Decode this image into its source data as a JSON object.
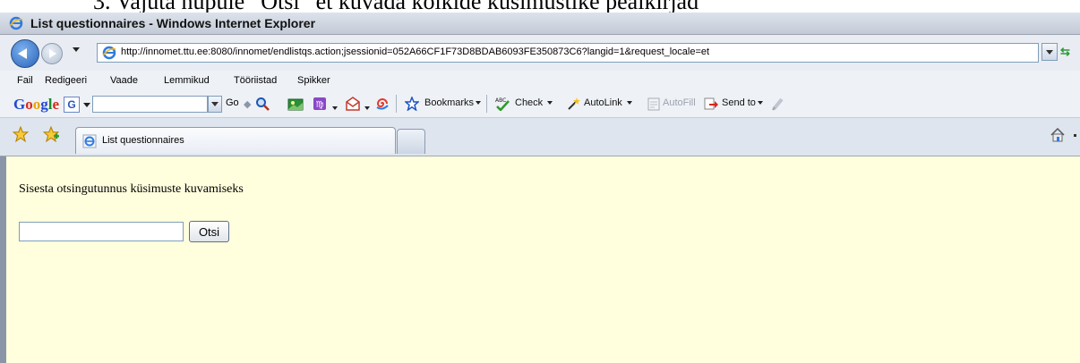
{
  "document": {
    "caption_text": "3.   Vajuta nupule “Otsi”          et kuvada kõikide küsimustike pealkirjad"
  },
  "window": {
    "title": "List questionnaires - Windows Internet Explorer"
  },
  "address_bar": {
    "url": "http://innomet.ttu.ee:8080/innomet/endlistqs.action;jsessionid=052A66CF1F73D8BDAB6093FE350873C6?langid=1&request_locale=et"
  },
  "menu": {
    "items": [
      "Fail",
      "Redigeeri",
      "Vaade",
      "Lemmikud",
      "Tööriistad",
      "Spikker"
    ]
  },
  "google_toolbar": {
    "go_label": "Go",
    "bookmarks_label": "Bookmarks",
    "check_label": "Check",
    "autolink_label": "AutoLink",
    "autofill_label": "AutoFill",
    "sendto_label": "Send to"
  },
  "tabs": {
    "active_title": "List questionnaires"
  },
  "page": {
    "prompt": "Sisesta otsingutunnus küsimuste kuvamiseks",
    "search_value": "",
    "search_button": "Otsi"
  },
  "colors": {
    "page_background": "#ffffdd",
    "accent": "#2a64b8"
  }
}
